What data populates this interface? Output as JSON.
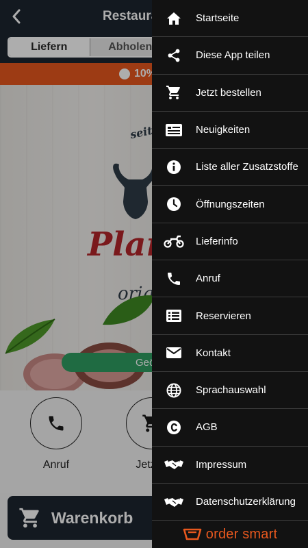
{
  "header": {
    "title": "Restaurant",
    "back_icon": "chevron-left-icon"
  },
  "order_mode": {
    "options": [
      "Liefern",
      "Abholen"
    ],
    "selected": "Liefern"
  },
  "promo": {
    "text": "10%"
  },
  "hero": {
    "logo_top": "seit",
    "logo_main": "Plan",
    "logo_sub": "orig",
    "status_pill": "Geö"
  },
  "actions": [
    {
      "label": "Anruf",
      "icon": "phone-icon"
    },
    {
      "label": "Jetzt b",
      "icon": "cart-icon"
    }
  ],
  "cart": {
    "label": "Warenkorb"
  },
  "drawer": {
    "items": [
      {
        "label": "Startseite",
        "icon": "home-icon"
      },
      {
        "label": "Diese App teilen",
        "icon": "share-icon"
      },
      {
        "label": "Jetzt bestellen",
        "icon": "cart-icon"
      },
      {
        "label": "Neuigkeiten",
        "icon": "news-icon"
      },
      {
        "label": "Liste aller Zusatzstoffe",
        "icon": "info-icon"
      },
      {
        "label": "Öffnungszeiten",
        "icon": "clock-icon"
      },
      {
        "label": "Lieferinfo",
        "icon": "motorcycle-icon"
      },
      {
        "label": "Anruf",
        "icon": "phone-icon"
      },
      {
        "label": "Reservieren",
        "icon": "list-icon"
      },
      {
        "label": "Kontakt",
        "icon": "mail-icon"
      },
      {
        "label": "Sprachauswahl",
        "icon": "globe-icon"
      },
      {
        "label": "AGB",
        "icon": "copyright-icon"
      },
      {
        "label": "Impressum",
        "icon": "handshake-icon"
      },
      {
        "label": "Datenschutzerklärung",
        "icon": "handshake-icon"
      }
    ],
    "footer_brand": "order smart"
  },
  "colors": {
    "accent": "#e8581e",
    "header_bg": "#1d2530",
    "drawer_bg": "#121212",
    "open_green": "#2e9e62"
  }
}
